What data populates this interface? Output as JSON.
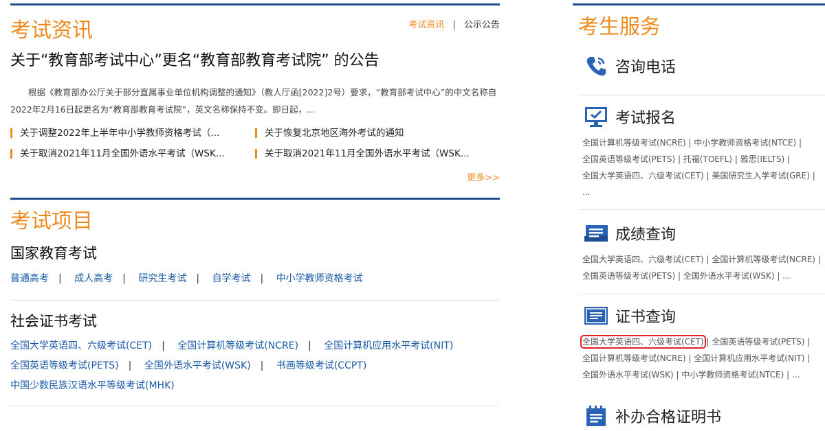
{
  "news_section": {
    "title": "考试资讯",
    "tabs": [
      "考试资讯",
      "公示公告"
    ],
    "tab_sep": "|",
    "headline": "关于“教育部考试中心”更名“教育部教育考试院” 的公告",
    "summary": "根据《教育部办公厅关于部分直属事业单位机构调整的通知》（教人厅函[2022]2号）要求，“教育部考试中心”的中文名称自2022年2月16日起更名为“教育部教育考试院”，英文名称保持不变。即日起，...",
    "items": [
      "关于调整2022年上半年中小学教师资格考试（...",
      "关于恢复北京地区海外考试的通知",
      "关于取消2021年11月全国外语水平考试（WSK...",
      "关于取消2021年11月全国外语水平考试（WSK..."
    ],
    "more": "更多>>"
  },
  "projects_section": {
    "title": "考试项目",
    "national": {
      "title": "国家教育考试",
      "links": [
        "普通高考",
        "成人高考",
        "研究生考试",
        "自学考试",
        "中小学教师资格考试"
      ]
    },
    "cert": {
      "title": "社会证书考试",
      "row1": [
        "全国大学英语四、六级考试(CET)",
        "全国计算机等级考试(NCRE)",
        "全国计算机应用水平考试(NIT)"
      ],
      "row2": [
        "全国英语等级考试(PETS)",
        "全国外语水平考试(WSK)",
        "书画等级考试(CCPT)"
      ],
      "row3": [
        "中国少数民族汉语水平等级考试(MHK)"
      ]
    }
  },
  "services": {
    "title": "考生服务",
    "hotline": {
      "label": "咨询电话"
    },
    "registration": {
      "label": "考试报名",
      "lines": [
        "全国计算机等级考试(NCRE) | 中小学教师资格考试(NTCE) |",
        "全国英语等级考试(PETS) | 托福(TOEFL) | 雅思(IELTS) |",
        "全国大学英语四、六级考试(CET) | 美国研究生入学考试(GRE) |",
        "..."
      ]
    },
    "scores": {
      "label": "成绩查询",
      "lines": [
        "全国大学英语四、六级考试(CET) | 全国计算机等级考试(NCRE) |",
        "全国英语等级考试(PETS) | 全国外语水平考试(WSK) | ..."
      ]
    },
    "certificate": {
      "label": "证书查询",
      "highlighted": "全国大学英语四、六级考试(CET)",
      "line1_rest": "| 全国英语等级考试(PETS) |",
      "lines": [
        "全国计算机等级考试(NCRE) | 全国计算机应用水平考试(NIT) |",
        "全国外语水平考试(WSK) | 中小学教师资格考试(NTCE) | ..."
      ]
    },
    "reissue": {
      "label": "补办合格证明书"
    }
  },
  "colors": {
    "accent": "#ef8a1f",
    "brand": "#1f4e8c",
    "link": "#1a5aa8",
    "highlight": "#e02020"
  }
}
